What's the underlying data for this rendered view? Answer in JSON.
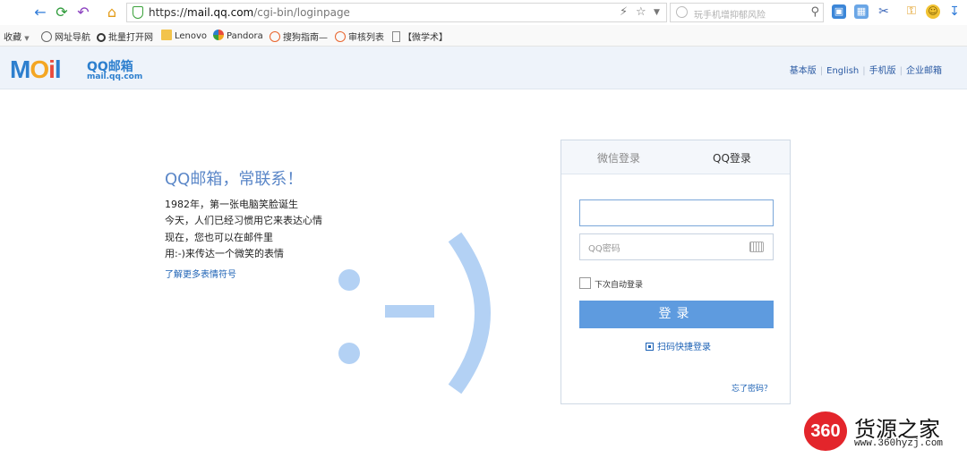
{
  "browser": {
    "url_prefix": "https://",
    "url_host": "mail.qq.com",
    "url_path": "/cgi-bin/loginpage",
    "search_placeholder": "玩手机增抑郁风险"
  },
  "bookmarks": {
    "favorites": "收藏",
    "items": [
      "网址导航",
      "批量打开网",
      "Lenovo",
      "Pandora",
      "搜狗指南—",
      "审核列表",
      "【微学术】"
    ]
  },
  "header": {
    "logo_text": "MOil",
    "logo_brand": "QQ邮箱",
    "logo_domain": "mail.qq.com",
    "links": [
      "基本版",
      "English",
      "手机版",
      "企业邮箱"
    ]
  },
  "promo": {
    "title": "QQ邮箱，常联系！",
    "lines": [
      "1982年，第一张电脑笑脸诞生",
      "今天，人们已经习惯用它来表达心情",
      "现在，您也可以在邮件里",
      "用:-)来传达一个微笑的表情"
    ],
    "more_link": "了解更多表情符号"
  },
  "login": {
    "tab_wechat": "微信登录",
    "tab_qq": "QQ登录",
    "account_value": "",
    "password_placeholder": "QQ密码",
    "remember_label": "下次自动登录",
    "remember_checked": false,
    "button_label": "登录",
    "qr_label": "扫码快捷登录",
    "forgot_label": "忘了密码？"
  },
  "watermark": {
    "badge": "360",
    "name": "货源之家",
    "url": "www.360hyzj.com"
  },
  "colors": {
    "accent": "#5e9bdf",
    "link": "#1d62b5",
    "header_bg": "#eef3fa",
    "smiley": "#b3d1f4",
    "watermark_red": "#e3252b"
  }
}
